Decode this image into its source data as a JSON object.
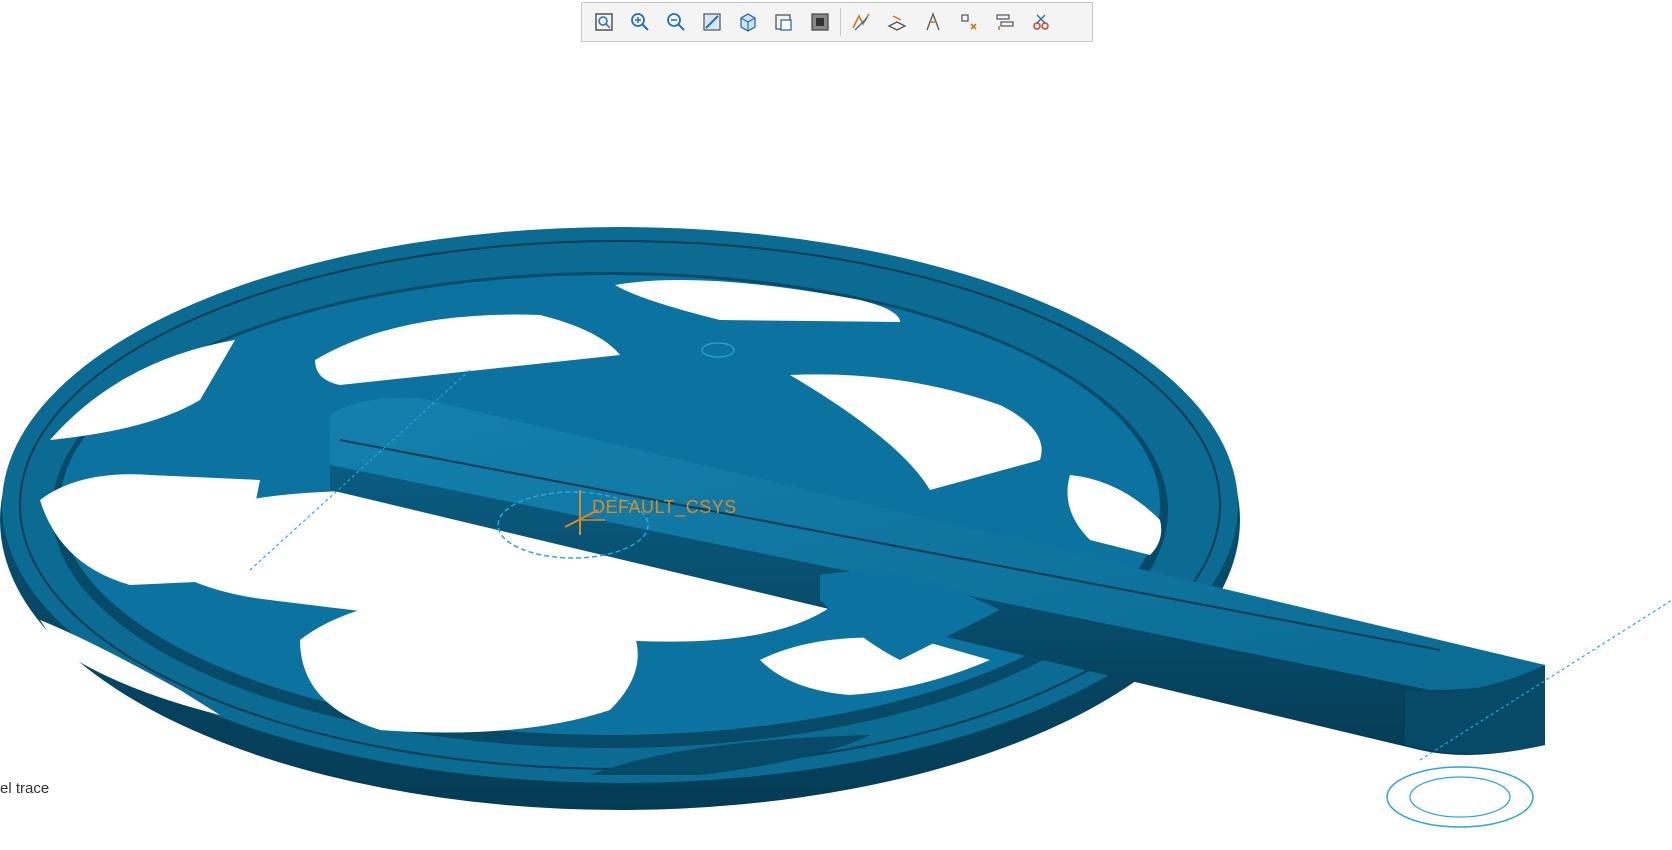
{
  "toolbar": {
    "buttons": [
      {
        "name": "zoom-fit",
        "icon": "zoom-fit-icon"
      },
      {
        "name": "zoom-in",
        "icon": "zoom-in-icon"
      },
      {
        "name": "zoom-out",
        "icon": "zoom-out-icon"
      },
      {
        "name": "repaint",
        "icon": "repaint-icon"
      },
      {
        "name": "saved-orientations",
        "icon": "view-cube-icon"
      },
      {
        "name": "view-manager",
        "icon": "view-manager-icon"
      },
      {
        "name": "display-style",
        "icon": "display-style-icon"
      },
      {
        "name": "datum-display",
        "icon": "datum-display-icon"
      },
      {
        "name": "plane-display",
        "icon": "plane-display-icon"
      },
      {
        "name": "axis-display",
        "icon": "axis-display-icon"
      },
      {
        "name": "point-display",
        "icon": "point-display-icon"
      },
      {
        "name": "csys-display",
        "icon": "csys-display-icon"
      },
      {
        "name": "annotation-display",
        "icon": "annotation-display-icon"
      }
    ]
  },
  "viewport": {
    "model_color": "#0b6b93",
    "model_shadow": "#064a68",
    "model_highlight": "#1480ad",
    "datum_color": "#2aa6d9",
    "csys_color": "#d9892a",
    "csys_label": "DEFAULT_CSYS"
  },
  "status": {
    "text": "el trace"
  }
}
